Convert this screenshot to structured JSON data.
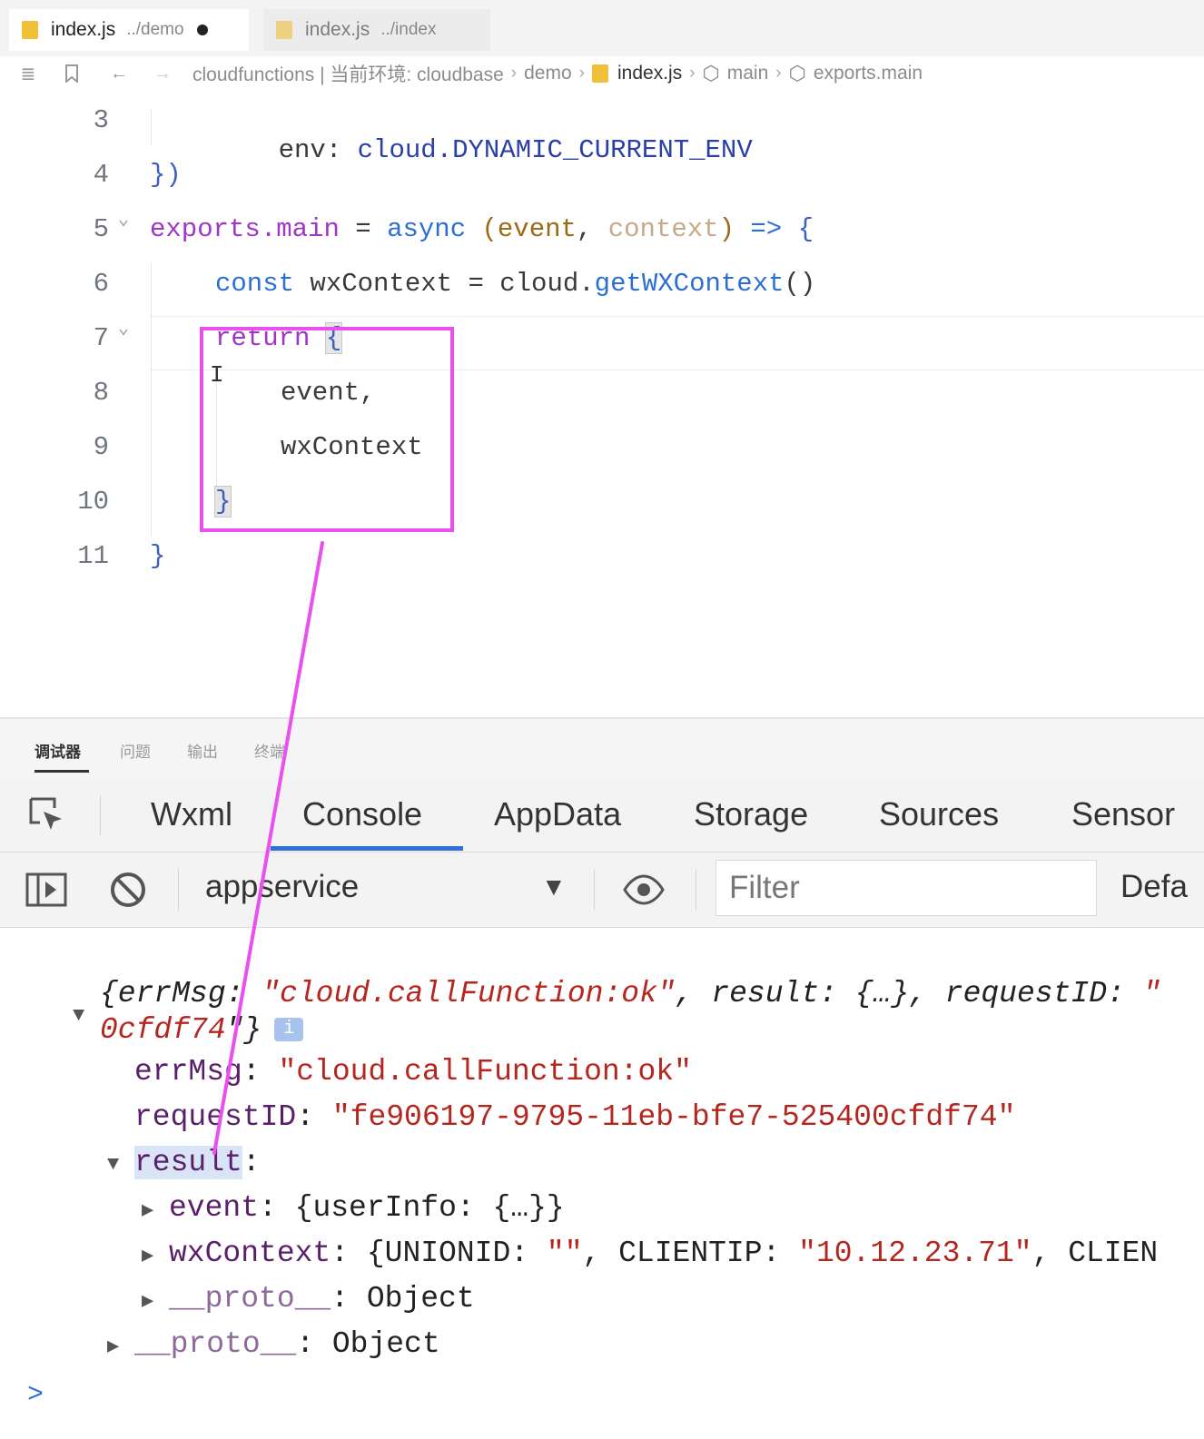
{
  "tabs": [
    {
      "name": "index.js",
      "path": "../demo",
      "dirty": true
    },
    {
      "name": "index.js",
      "path": "../index"
    }
  ],
  "breadcrumb": {
    "root": "cloudfunctions | 当前环境: cloudbase",
    "folder": "demo",
    "file": "index.js",
    "symbol1": "main",
    "symbol2": "exports.main"
  },
  "code": {
    "line_numbers": [
      "3",
      "4",
      "5",
      "6",
      "7",
      "8",
      "9",
      "10",
      "11"
    ],
    "l3_key": "env:",
    "l3_val_obj": "cloud.",
    "l3_val_prop": "DYNAMIC_CURRENT_ENV",
    "l4": "})",
    "l5_obj": "exports.",
    "l5_prop": "main",
    "l5_eq": " = ",
    "l5_async": "async",
    "l5_open": " (",
    "l5_p1": "event",
    "l5_comma": ", ",
    "l5_p2": "context",
    "l5_close": ")",
    "l5_arrow": " => ",
    "l5_brace": "{",
    "l6_const": "const",
    "l6_var": " wxContext = cloud.",
    "l6_fn": "getWXContext",
    "l6_end": "()",
    "l7_return": "return",
    "l7_brace": "{",
    "l8": "event,",
    "l9": "wxContext",
    "l10": "}",
    "l11": "}"
  },
  "panel_tabs": [
    "调试器",
    "问题",
    "输出",
    "终端"
  ],
  "devtools_tabs": [
    "Wxml",
    "Console",
    "AppData",
    "Storage",
    "Sources",
    "Sensor"
  ],
  "console_toolbar": {
    "context": "appservice",
    "filter_placeholder": "Filter",
    "levels": "Defa"
  },
  "console": {
    "summary_line1_a": "{errMsg: ",
    "summary_line1_b": "\"cloud.callFunction:ok\"",
    "summary_line1_c": ", result: {…}, requestID: ",
    "summary_line1_d": "\"",
    "summary_line2_a": "0cfdf74",
    "summary_line2_b": "\"}",
    "info_badge": "i",
    "errmsg_key": "errMsg",
    "errmsg_val": "\"cloud.callFunction:ok\"",
    "requestid_key": "requestID",
    "requestid_val": "\"fe906197-9795-11eb-bfe7-525400cfdf74\"",
    "result_key": "result",
    "event_key": "event",
    "event_val": "{userInfo: {…}}",
    "wxcontext_key": "wxContext",
    "wxcontext_val_a": "{UNIONID: ",
    "wxcontext_val_b": "\"\"",
    "wxcontext_val_c": ", CLIENTIP: ",
    "wxcontext_val_d": "\"10.12.23.71\"",
    "wxcontext_val_e": ", CLIEN",
    "proto_key": "__proto__",
    "proto_val": "Object",
    "prompt": ">"
  },
  "colors": {
    "annotation": "#ea4ff0",
    "accent": "#2f6fd8"
  }
}
